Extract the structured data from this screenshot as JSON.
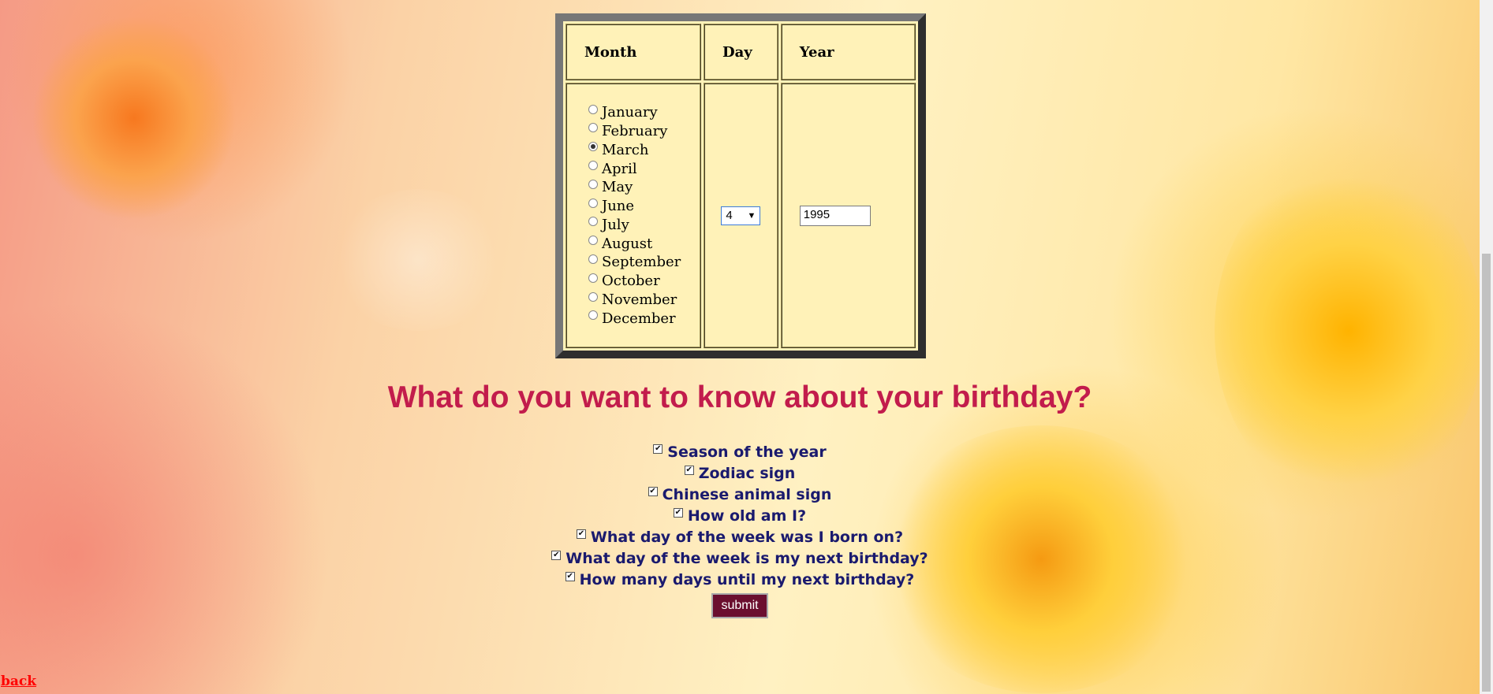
{
  "table": {
    "headers": {
      "month": "Month",
      "day": "Day",
      "year": "Year"
    },
    "months": [
      "January",
      "February",
      "March",
      "April",
      "May",
      "June",
      "July",
      "August",
      "September",
      "October",
      "November",
      "December"
    ],
    "selected_month": "March",
    "day_value": "4",
    "year_value": "1995"
  },
  "question": "What do you want to know about your birthday?",
  "options": [
    "Season of the year",
    "Zodiac sign",
    "Chinese animal sign",
    "How old am I?",
    "What day of the week was I born on?",
    "What day of the week is my next birthday?",
    "How many days until my next birthday?"
  ],
  "submit_label": "submit",
  "back_label": "back",
  "colors": {
    "question": "#c21c4c",
    "options": "#1a1a6e",
    "submit_bg": "#6b0f2f",
    "back_link": "#ff0000"
  }
}
